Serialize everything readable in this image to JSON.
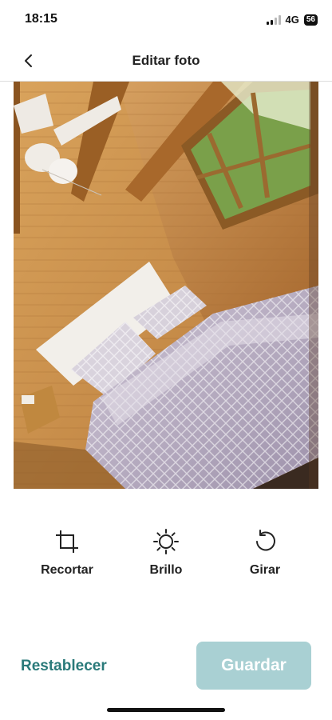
{
  "status_bar": {
    "time": "18:15",
    "network": "4G",
    "battery": "56"
  },
  "header": {
    "title": "Editar foto",
    "back_icon": "chevron-left-icon"
  },
  "photo": {
    "alt": "Dormitorio con paredes de madera, cama doble y ventana"
  },
  "tools": [
    {
      "label": "Recortar",
      "icon": "crop-icon"
    },
    {
      "label": "Brillo",
      "icon": "brightness-icon"
    },
    {
      "label": "Girar",
      "icon": "rotate-icon"
    }
  ],
  "footer": {
    "reset_label": "Restablecer",
    "save_label": "Guardar"
  },
  "colors": {
    "accent": "#2a7a7a",
    "save_disabled": "#a9d0d3"
  }
}
